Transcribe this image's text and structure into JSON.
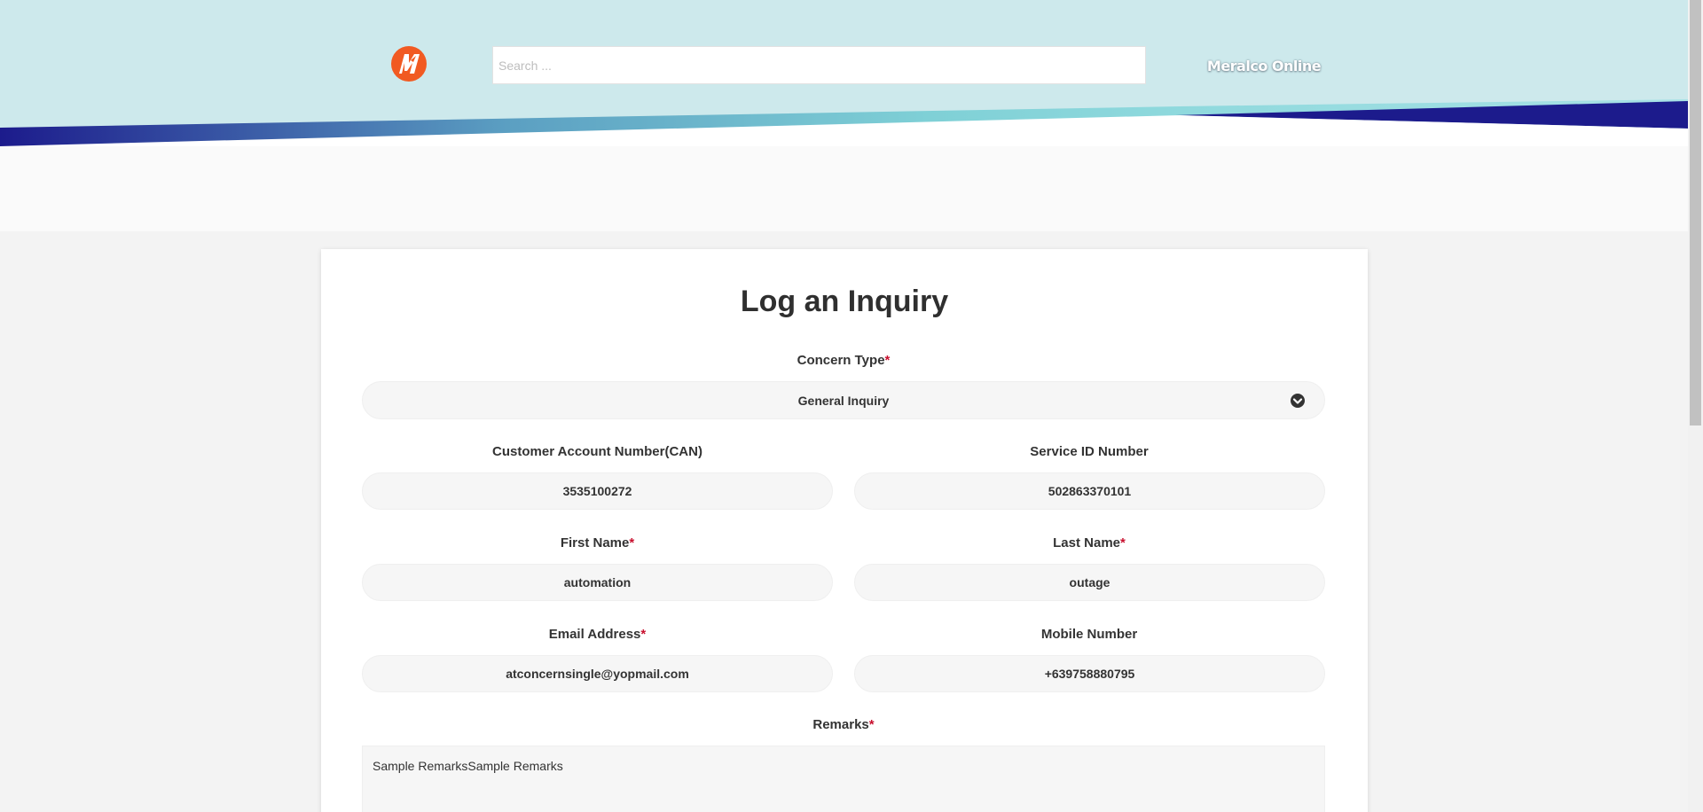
{
  "header": {
    "search_placeholder": "Search ...",
    "brand_text": "Meralco Online"
  },
  "form": {
    "title": "Log an Inquiry",
    "concern_type": {
      "label": "Concern Type",
      "required_mark": "*",
      "value": "General Inquiry"
    },
    "can": {
      "label": "Customer Account Number(CAN)",
      "value": "3535100272"
    },
    "service_id": {
      "label": "Service ID Number",
      "value": "502863370101"
    },
    "first_name": {
      "label": "First Name",
      "required_mark": "*",
      "value": "automation"
    },
    "last_name": {
      "label": "Last Name",
      "required_mark": "*",
      "value": "outage"
    },
    "email": {
      "label": "Email Address",
      "required_mark": "*",
      "value": "atconcernsingle@yopmail.com"
    },
    "mobile": {
      "label": "Mobile Number",
      "value": "+639758880795"
    },
    "remarks": {
      "label": "Remarks",
      "required_mark": "*",
      "value": "Sample RemarksSample Remarks"
    }
  },
  "colors": {
    "header_bg": "#cde9ec",
    "brand_orange": "#f15a22",
    "navy": "#1c1b8c",
    "teal": "#6cc6cf",
    "required": "#c8102e"
  },
  "icons": {
    "logo": "meralco-logo-icon",
    "select": "chevron-down-icon"
  }
}
